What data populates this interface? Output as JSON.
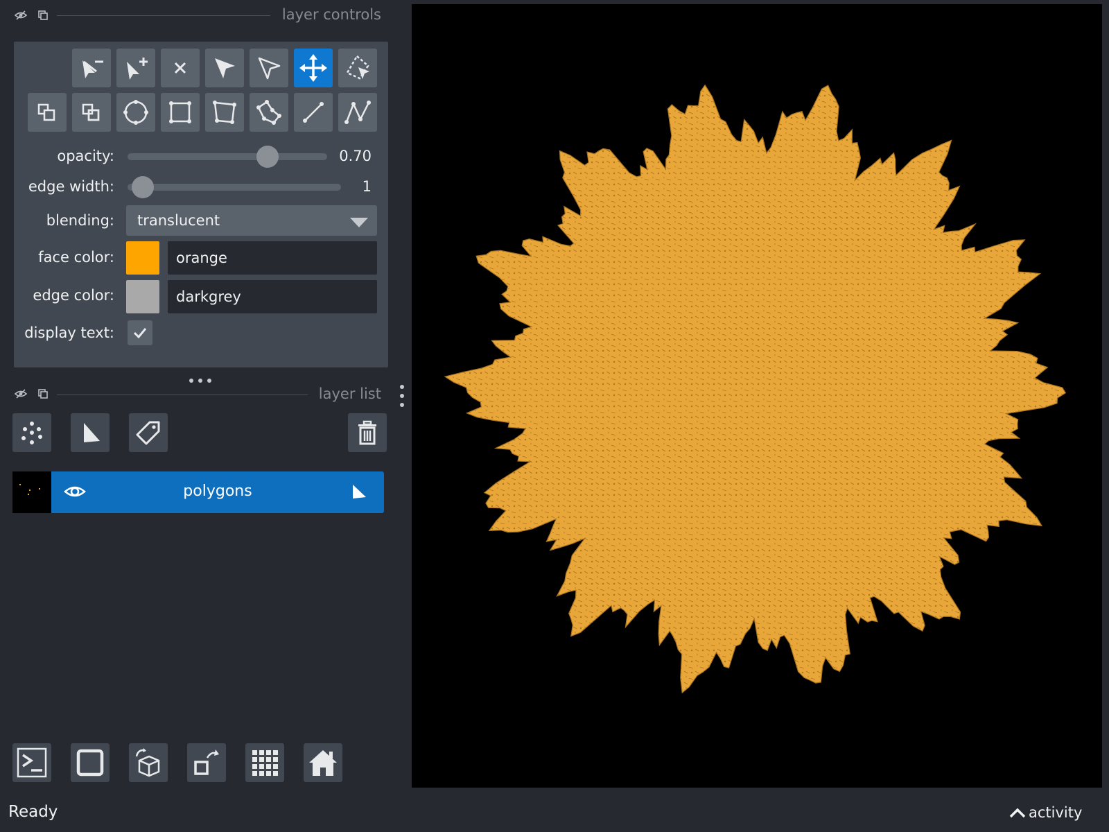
{
  "layer_controls": {
    "title": "layer controls",
    "opacity_label": "opacity:",
    "opacity_value": "0.70",
    "opacity_fraction": 0.7,
    "edge_width_label": "edge width:",
    "edge_width_value": "1",
    "blending_label": "blending:",
    "blending_value": "translucent",
    "face_color_label": "face color:",
    "face_color_value": "orange",
    "face_color_hex": "#ffa500",
    "edge_color_label": "edge color:",
    "edge_color_value": "darkgrey",
    "edge_color_hex": "#a9a9a9",
    "display_text_label": "display text:",
    "display_text_checked": true,
    "tools_row1": [
      "remove-vertex-icon",
      "add-vertex-icon",
      "delete-shape-icon",
      "select-icon",
      "direct-select-icon",
      "pan-zoom-icon",
      "select-region-icon"
    ],
    "tools_row2": [
      "move-back-icon",
      "move-front-icon",
      "ellipse-icon",
      "rectangle-icon",
      "polygon-icon",
      "lasso-icon",
      "line-icon",
      "path-icon"
    ],
    "active_tool": "pan-zoom-icon"
  },
  "layer_list": {
    "title": "layer list",
    "layers": [
      {
        "name": "polygons",
        "visible": true,
        "type": "shapes-icon"
      }
    ]
  },
  "status_bar": {
    "status": "Ready",
    "activity_label": "activity"
  },
  "colors": {
    "accent": "#0f78d0",
    "background": "#262930",
    "panel": "#414851",
    "fractal": "#e9a73a"
  }
}
